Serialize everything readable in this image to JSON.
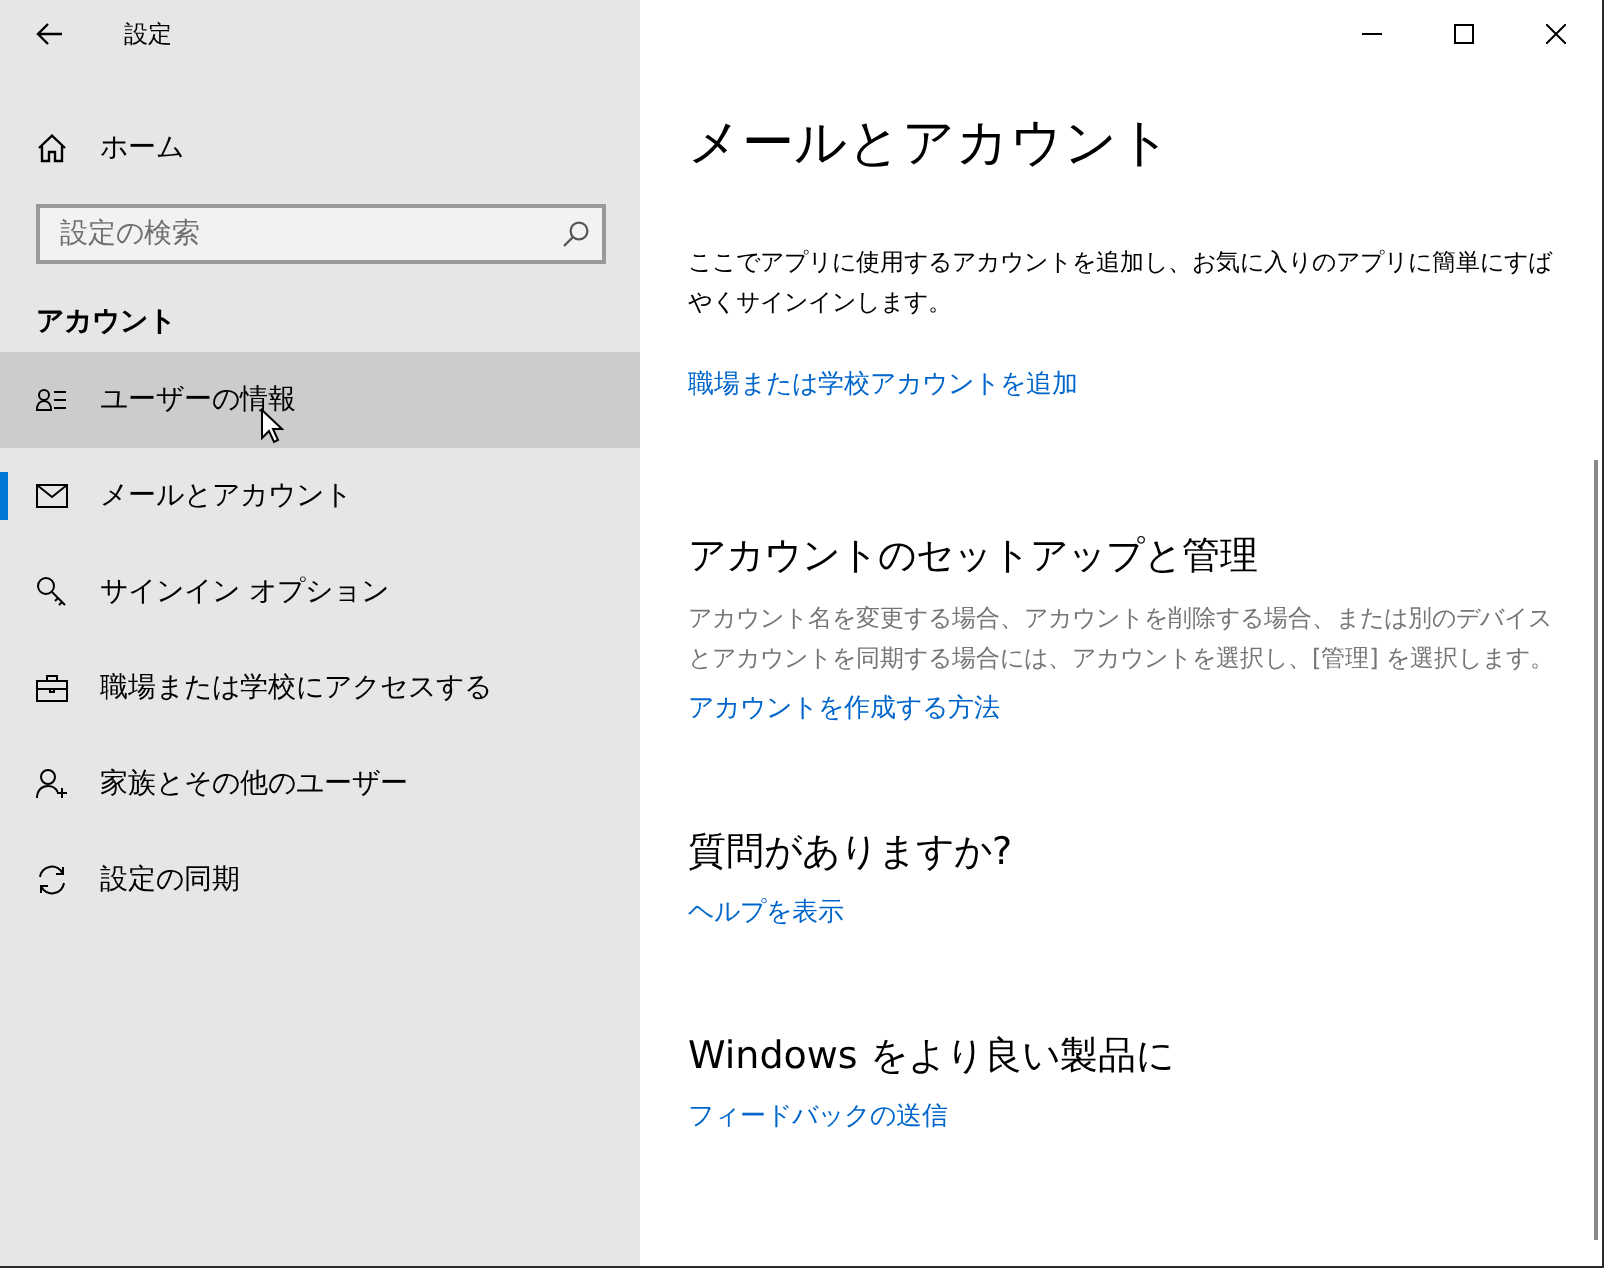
{
  "window": {
    "title": "設定"
  },
  "sidebar": {
    "home": "ホーム",
    "search": {
      "placeholder": "設定の検索"
    },
    "section": "アカウント",
    "items": [
      {
        "label": "ユーザーの情報",
        "selected": false,
        "hovered": true
      },
      {
        "label": "メールとアカウント",
        "selected": true,
        "hovered": false
      },
      {
        "label": "サインイン オプション",
        "selected": false,
        "hovered": false
      },
      {
        "label": "職場または学校にアクセスする",
        "selected": false,
        "hovered": false
      },
      {
        "label": "家族とその他のユーザー",
        "selected": false,
        "hovered": false
      },
      {
        "label": "設定の同期",
        "selected": false,
        "hovered": false
      }
    ]
  },
  "content": {
    "title": "メールとアカウント",
    "intro": "ここでアプリに使用するアカウントを追加し、お気に入りのアプリに簡単にすばやくサインインします。",
    "intro_link": "職場または学校アカウントを追加",
    "sections": [
      {
        "heading": "アカウントのセットアップと管理",
        "text": "アカウント名を変更する場合、アカウントを削除する場合、または別のデバイスとアカウントを同期する場合には、アカウントを選択し、[管理] を選択します。",
        "link": "アカウントを作成する方法"
      },
      {
        "heading": "質問がありますか?",
        "link": "ヘルプを表示"
      },
      {
        "heading": "Windows をより良い製品に",
        "link": "フィードバックの送信"
      }
    ]
  }
}
